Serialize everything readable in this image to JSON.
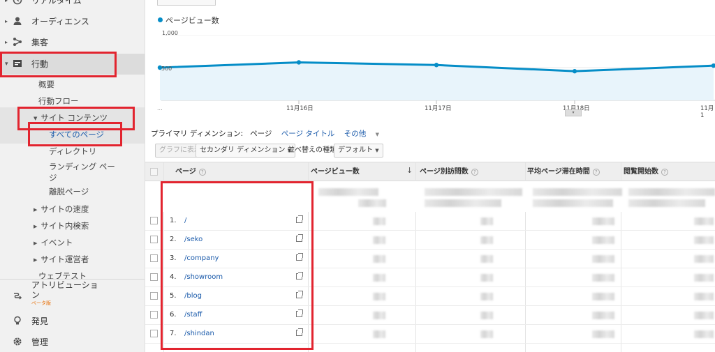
{
  "sidebar": {
    "top_partial": "リアルタイム",
    "audience": "オーディエンス",
    "acquisition": "集客",
    "behavior": "行動",
    "overview": "概要",
    "behavior_flow": "行動フロー",
    "site_content": "サイト コンテンツ",
    "all_pages": "すべてのページ",
    "directory": "ディレクトリ",
    "landing_line1": "ランディング ペー",
    "landing_line2": "ジ",
    "exit_pages": "離脱ページ",
    "site_speed": "サイトの速度",
    "site_search": "サイト内検索",
    "events": "イベント",
    "publisher": "サイト運営者",
    "experiments_partial": "ウェブテスト",
    "attribution_line1": "アトリビューショ",
    "attribution_line2": "ン",
    "beta": "ベータ版",
    "discover": "発見",
    "admin": "管理"
  },
  "chart": {
    "legend": "ページビュー数",
    "y_top": "1,000",
    "y_mid": "500",
    "x_start": "...",
    "x_labels": [
      "11月16日",
      "11月17日",
      "11月18日",
      "11月1"
    ]
  },
  "chart_data": {
    "type": "area",
    "series": [
      {
        "name": "ページビュー数",
        "values": [
          500,
          580,
          540,
          445,
          530
        ]
      }
    ],
    "ylim": [
      0,
      1000
    ]
  },
  "dimension": {
    "label": "プライマリ ディメンション:",
    "page": "ページ",
    "page_title": "ページ タイトル",
    "other": "その他"
  },
  "controls": {
    "graph_display": "グラフに表示",
    "secondary_dimension": "セカンダリ ディメンション",
    "sort_type_label": "並べ替えの種類:",
    "sort_default": "デフォルト"
  },
  "table": {
    "headers": {
      "page": "ページ",
      "pageviews": "ページビュー数",
      "unique_pageviews": "ページ別訪問数",
      "avg_time": "平均ページ滞在時間",
      "entrances": "閲覧開始数"
    },
    "rows": [
      {
        "num": "1.",
        "path": "/"
      },
      {
        "num": "2.",
        "path": "/seko"
      },
      {
        "num": "3.",
        "path": "/company"
      },
      {
        "num": "4.",
        "path": "/showroom"
      },
      {
        "num": "5.",
        "path": "/blog"
      },
      {
        "num": "6.",
        "path": "/staff"
      },
      {
        "num": "7.",
        "path": "/shindan"
      }
    ]
  },
  "colors": {
    "accent": "#058dc7",
    "highlight": "#e2242f",
    "link": "#1a5aaa"
  }
}
